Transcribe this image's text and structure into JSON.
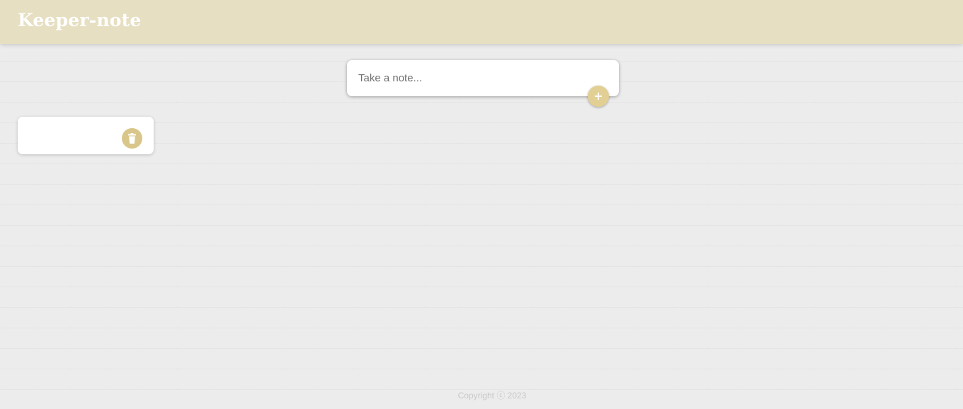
{
  "header": {
    "title": "Keeper-note"
  },
  "create_note": {
    "placeholder": "Take a note...",
    "value": "",
    "add_icon": "plus-icon",
    "add_label": "+"
  },
  "notes": [
    {
      "title": "",
      "content": "",
      "delete_icon": "trash-icon"
    }
  ],
  "footer": {
    "copyright": "Copyright ⓒ 2023"
  },
  "colors": {
    "header_bg": "#e6dfc2",
    "accent": "#e2cf94",
    "background": "#ececec"
  }
}
